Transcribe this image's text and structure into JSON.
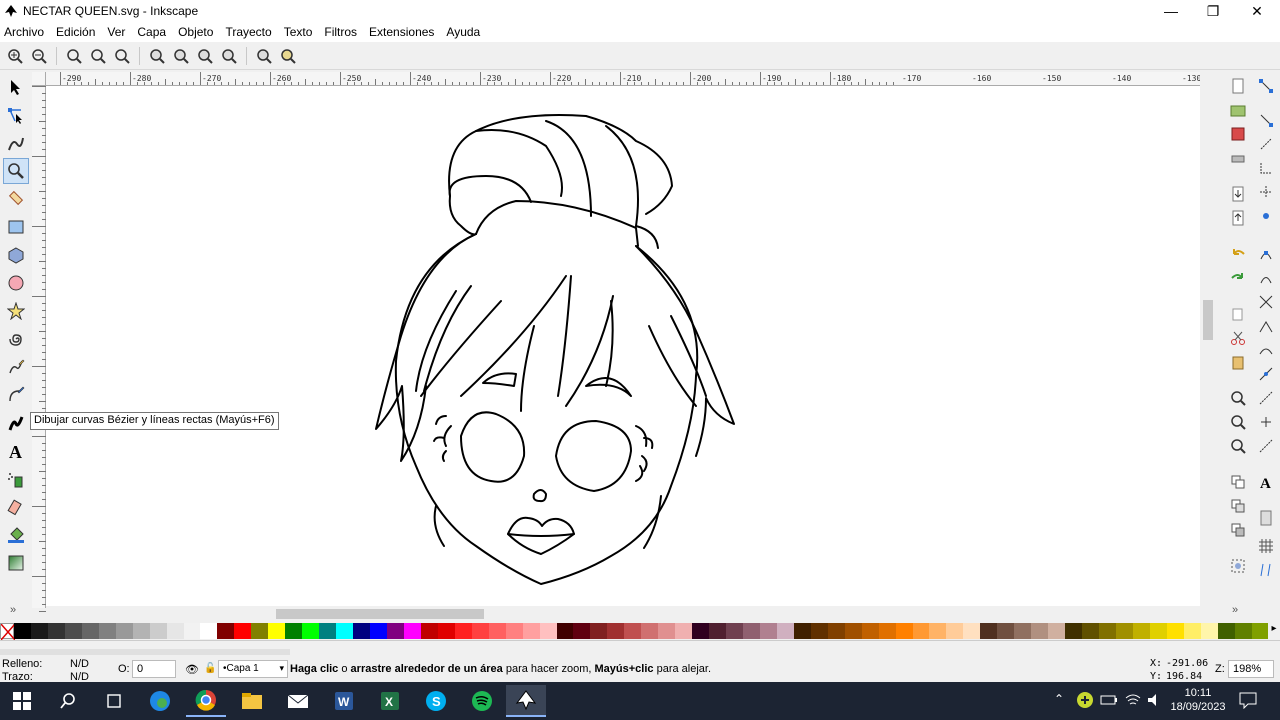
{
  "window": {
    "title": "NECTAR QUEEN.svg - Inkscape",
    "controls": [
      "—",
      "❐",
      "✕"
    ]
  },
  "menu": [
    "Archivo",
    "Edición",
    "Ver",
    "Capa",
    "Objeto",
    "Trayecto",
    "Texto",
    "Filtros",
    "Extensiones",
    "Ayuda"
  ],
  "ruler": {
    "h_ticks": [
      "-290",
      "-280",
      "-270",
      "-260",
      "-250",
      "-240",
      "-230",
      "-220",
      "-210",
      "-200",
      "-190",
      "-180",
      "-170",
      "-160",
      "-150",
      "-140",
      "-130"
    ]
  },
  "tooltip": "Dibujar curvas Bézier y líneas rectas (Mayús+F6)",
  "tools": [
    {
      "name": "selector-tool-icon"
    },
    {
      "name": "node-tool-icon"
    },
    {
      "name": "tweak-tool-icon"
    },
    {
      "name": "zoom-tool-icon"
    },
    {
      "name": "measure-tool-icon"
    },
    {
      "name": "rect-tool-icon"
    },
    {
      "name": "3dbox-tool-icon"
    },
    {
      "name": "ellipse-tool-icon"
    },
    {
      "name": "star-tool-icon"
    },
    {
      "name": "spiral-tool-icon"
    },
    {
      "name": "pencil-tool-icon"
    },
    {
      "name": "bezier-tool-icon"
    },
    {
      "name": "calligraphy-tool-icon"
    },
    {
      "name": "text-tool-icon"
    },
    {
      "name": "spray-tool-icon"
    },
    {
      "name": "eraser-tool-icon"
    },
    {
      "name": "bucket-tool-icon"
    },
    {
      "name": "gradient-tool-icon"
    }
  ],
  "status": {
    "fill_label": "Relleno:",
    "fill_value": "N/D",
    "stroke_label": "Trazo:",
    "stroke_value": "N/D",
    "opacity_label": "O:",
    "opacity_value": "0",
    "layer": "•Capa 1",
    "message_bold1": "Haga clic",
    "message_part1": " o ",
    "message_bold2": "arrastre alrededor de un área",
    "message_part2": " para hacer zoom, ",
    "message_bold3": "Mayús+clic",
    "message_part3": " para alejar.",
    "x_label": "X:",
    "x_value": "-291.06",
    "y_label": "Y:",
    "y_value": "196.84",
    "zoom_label": "Z:",
    "zoom_value": "198%"
  },
  "taskbar": {
    "time": "10:11",
    "date": "18/09/2023"
  },
  "palette": [
    "#000000",
    "#1a1a1a",
    "#333333",
    "#4d4d4d",
    "#666666",
    "#808080",
    "#999999",
    "#b3b3b3",
    "#cccccc",
    "#e6e6e6",
    "#f2f2f2",
    "#ffffff",
    "#800000",
    "#ff0000",
    "#808000",
    "#ffff00",
    "#008000",
    "#00ff00",
    "#008080",
    "#00ffff",
    "#000080",
    "#0000ff",
    "#800080",
    "#ff00ff",
    "#c00000",
    "#e00000",
    "#ff2020",
    "#ff4040",
    "#ff6060",
    "#ff8080",
    "#ffa0a0",
    "#ffc0c0",
    "#400000",
    "#600010",
    "#802020",
    "#a03030",
    "#c05050",
    "#d07070",
    "#e09090",
    "#f0b0b0",
    "#300020",
    "#502030",
    "#704050",
    "#906070",
    "#b08090",
    "#d0b0c0",
    "#402000",
    "#603000",
    "#804000",
    "#a05000",
    "#c06000",
    "#e07000",
    "#ff8000",
    "#ff9933",
    "#ffb366",
    "#ffcc99",
    "#ffe0c0",
    "#503020",
    "#705040",
    "#907060",
    "#b09080",
    "#d0b0a0",
    "#403000",
    "#605000",
    "#807000",
    "#a09000",
    "#c0b000",
    "#e0d000",
    "#ffe000",
    "#ffee66",
    "#fff5aa",
    "#406000",
    "#608000",
    "#80a000"
  ]
}
